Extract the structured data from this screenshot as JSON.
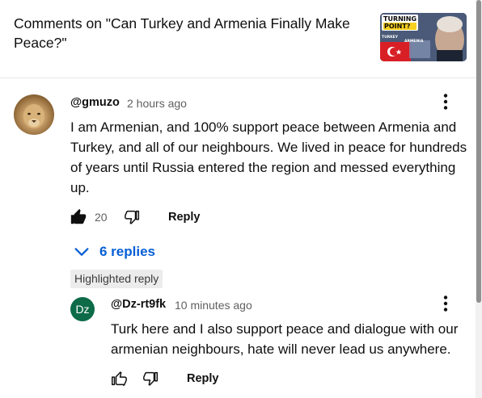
{
  "header": {
    "title": "Comments on \"Can Turkey and Armenia Finally Make Peace?\"",
    "thumbnail": {
      "line1": "TURNING",
      "line2": "POINT?",
      "label_left": "TURKEY",
      "label_right": "ARMENIA"
    }
  },
  "comment": {
    "author": "@gmuzo",
    "time": "2 hours ago",
    "text": "I am Armenian, and 100% support peace between Armenia and Turkey, and all of our neighbours. We lived in peace for hundreds of years until Russia entered the region and messed everything up.",
    "likes": "20",
    "reply_label": "Reply",
    "replies_toggle": "6 replies"
  },
  "highlighted_label": "Highlighted reply",
  "reply": {
    "avatar_initials": "Dz",
    "author": "@Dz-rt9fk",
    "time": "10 minutes ago",
    "text": "Turk here and I also support peace and dialogue with our armenian neighbours, hate will never lead us anywhere.",
    "reply_label": "Reply"
  },
  "icons": {
    "more": "more-vertical-icon",
    "like_filled": "thumb-up-filled-icon",
    "like": "thumb-up-icon",
    "dislike": "thumb-down-icon",
    "chevron": "chevron-down-icon"
  },
  "colors": {
    "link_blue": "#065fd4",
    "avatar_green": "#0d6b48"
  }
}
